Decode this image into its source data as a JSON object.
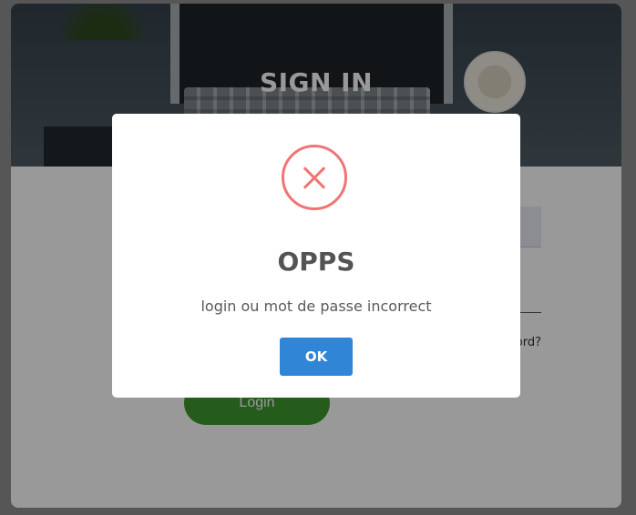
{
  "hero": {
    "title": "SIGN IN"
  },
  "form": {
    "forgot_label": "Forgot password?",
    "login_label": "Login"
  },
  "modal": {
    "icon": "error-x-icon",
    "title": "OPPS",
    "message": "login ou mot de passe incorrect",
    "ok_label": "OK"
  },
  "colors": {
    "error_red": "#f27474",
    "ok_blue": "#3085d6",
    "login_green": "#3e9a2f"
  }
}
